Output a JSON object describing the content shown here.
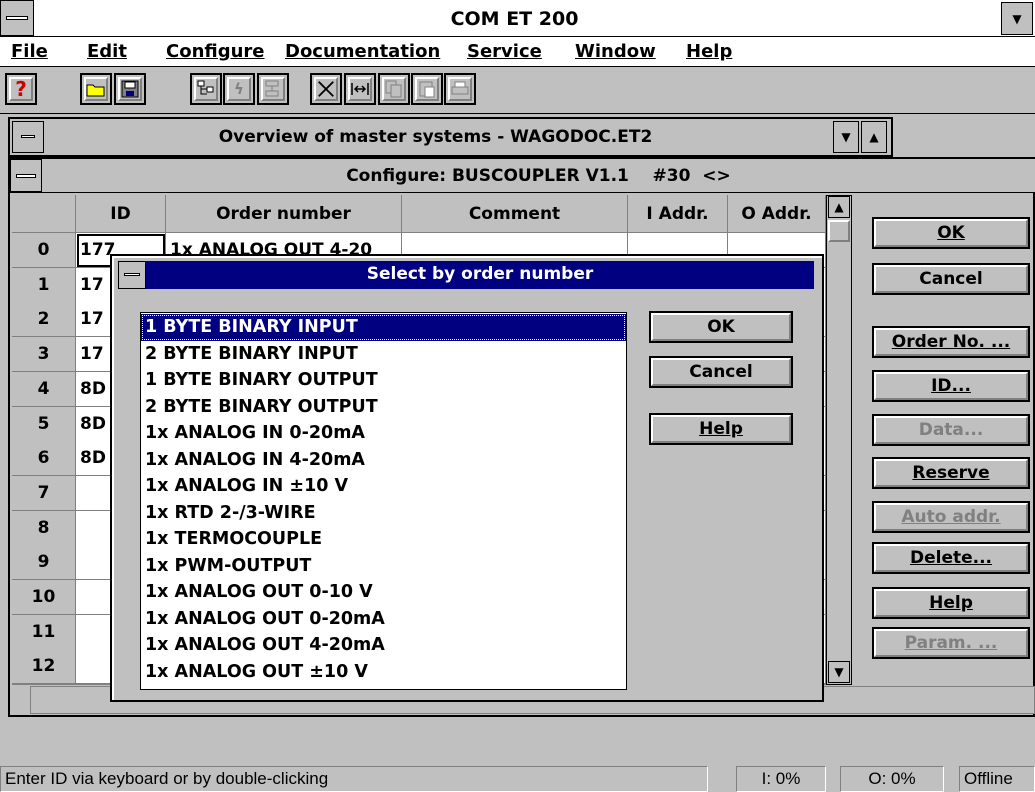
{
  "app": {
    "title": "COM ET 200"
  },
  "menu": [
    {
      "label": "File"
    },
    {
      "label": "Edit"
    },
    {
      "label": "Configure"
    },
    {
      "label": "Documentation"
    },
    {
      "label": "Service"
    },
    {
      "label": "Window"
    },
    {
      "label": "Help"
    }
  ],
  "toolbar": {
    "help_icon": "question-icon",
    "open_icon": "open-folder-icon",
    "save_icon": "save-icon",
    "tree_icon": "tree-icon",
    "cut_icon": "scissors-icon"
  },
  "overview_window": {
    "title": "Overview of master systems - WAGODOC.ET2"
  },
  "configure_window": {
    "title": "Configure: BUSCOUPLER V1.1    #30  <>"
  },
  "grid": {
    "columns": [
      "ID",
      "Order number",
      "Comment",
      "I Addr.",
      "O Addr."
    ],
    "rows": [
      {
        "num": "0",
        "id": "177",
        "order": "1x ANALOG OUT 4-20"
      },
      {
        "num": "1",
        "id": "17"
      },
      {
        "num": "2",
        "id": "17"
      },
      {
        "num": "3",
        "id": "17"
      },
      {
        "num": "4",
        "id": "8D"
      },
      {
        "num": "5",
        "id": "8D"
      },
      {
        "num": "6",
        "id": "8D"
      },
      {
        "num": "7",
        "id": ""
      },
      {
        "num": "8",
        "id": ""
      },
      {
        "num": "9",
        "id": ""
      },
      {
        "num": "10",
        "id": ""
      },
      {
        "num": "11",
        "id": ""
      },
      {
        "num": "12",
        "id": ""
      }
    ]
  },
  "side_buttons": {
    "ok": "OK",
    "cancel": "Cancel",
    "order_no": "Order No. ...",
    "id": "ID...",
    "data": "Data...",
    "reserve": "Reserve",
    "auto_addr": "Auto addr.",
    "delete": "Delete...",
    "help": "Help",
    "param": "Param. ..."
  },
  "dialog": {
    "title": "Select by order number",
    "items": [
      "1 BYTE BINARY INPUT",
      "2 BYTE BINARY INPUT",
      "1 BYTE BINARY OUTPUT",
      "2 BYTE BINARY OUTPUT",
      "1x ANALOG IN 0-20mA",
      "1x ANALOG IN 4-20mA",
      "1x ANALOG IN  ±10 V",
      "1x RTD 2-/3-WIRE",
      "1x TERMOCOUPLE",
      "1x PWM-OUTPUT",
      "1x ANALOG OUT 0-10 V",
      "1x ANALOG OUT 0-20mA",
      "1x ANALOG OUT 4-20mA",
      "1x ANALOG OUT  ±10 V"
    ],
    "selected_index": 0,
    "ok": "OK",
    "cancel": "Cancel",
    "help": "Help"
  },
  "status": {
    "message": "Enter ID via keyboard or by double-clicking",
    "input": "I: 0%",
    "output": "O: 0%",
    "mode": "Offline"
  },
  "colors": {
    "face": "#c0c0c0",
    "title_active": "#000080",
    "selection": "#000080"
  }
}
